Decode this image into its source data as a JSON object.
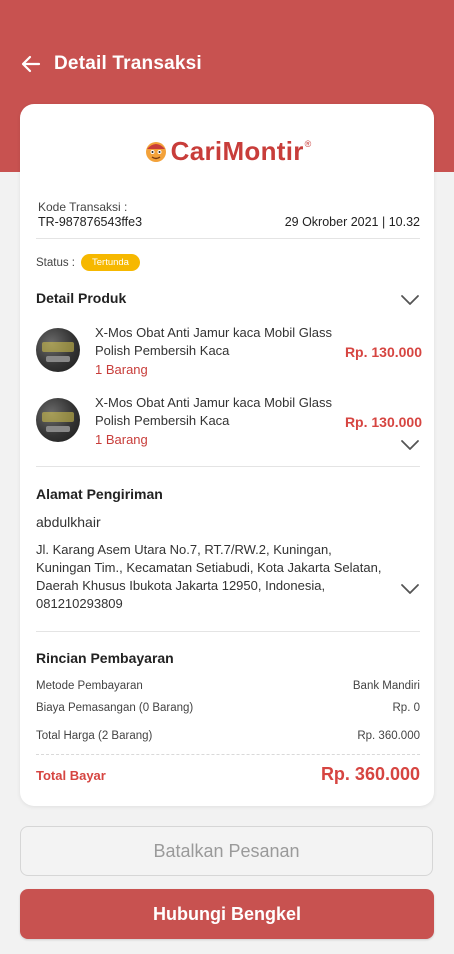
{
  "header": {
    "title": "Detail Transaksi",
    "back_icon": "arrow-left-icon"
  },
  "brand": {
    "name": "CariMontir",
    "registered": "®"
  },
  "transaction": {
    "code_label": "Kode Transaksi :",
    "code": "TR-987876543ffe3",
    "date": "29 Okrober 2021 | 10.32",
    "status_label": "Status :",
    "status": "Tertunda"
  },
  "products": {
    "title": "Detail Produk",
    "items": [
      {
        "name": "X-Mos Obat Anti Jamur kaca Mobil Glass Polish Pembersih Kaca",
        "qty": "1 Barang",
        "price": "Rp. 130.000"
      },
      {
        "name": "X-Mos Obat Anti Jamur kaca Mobil Glass Polish Pembersih Kaca",
        "qty": "1 Barang",
        "price": "Rp. 130.000"
      }
    ]
  },
  "shipping": {
    "title": "Alamat Pengiriman",
    "recipient": "abdulkhair",
    "address": "Jl. Karang Asem Utara No.7, RT.7/RW.2, Kuningan, Kuningan Tim.,  Kecamatan Setiabudi, Kota Jakarta Selatan, Daerah Khusus Ibukota Jakarta 12950, Indonesia, 081210293809"
  },
  "payment": {
    "title": "Rincian Pembayaran",
    "rows": [
      {
        "label": "Metode Pembayaran",
        "value": "Bank Mandiri"
      },
      {
        "label": "Biaya Pemasangan (0 Barang)",
        "value": "Rp. 0"
      },
      {
        "label": "Total Harga (2 Barang)",
        "value": "Rp. 360.000"
      }
    ],
    "total_label": "Total Bayar",
    "total_value": "Rp. 360.000"
  },
  "actions": {
    "cancel_label": "Batalkan Pesanan",
    "contact_label": "Hubungi Bengkel"
  },
  "colors": {
    "primary": "#c85250",
    "accent_red": "#d64541",
    "status_pending": "#f6b800"
  }
}
